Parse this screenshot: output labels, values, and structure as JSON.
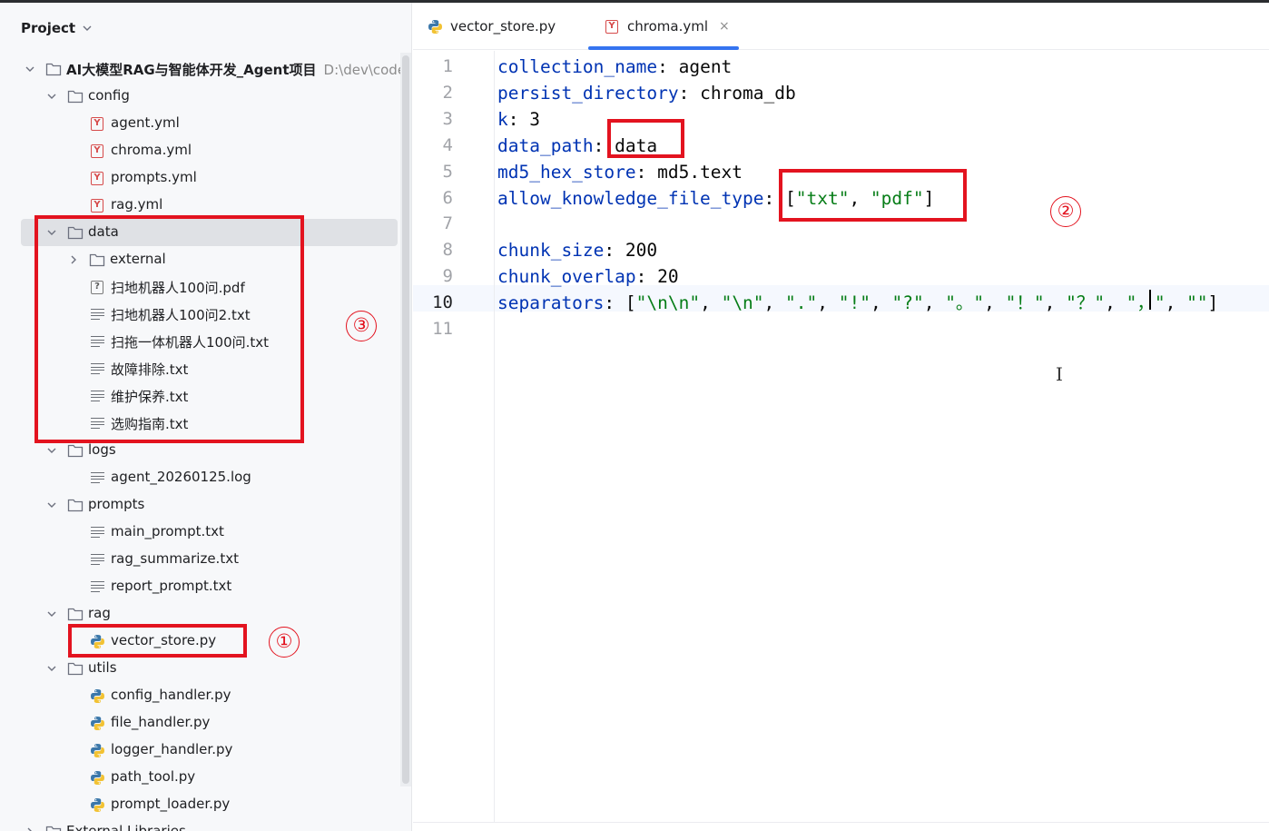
{
  "panel": {
    "title": "Project"
  },
  "tree": [
    {
      "label": "AI大模型RAG与智能体开发_Agent项目",
      "path": "D:\\dev\\code\\p",
      "kind": "folder",
      "expanded": true
    },
    {
      "label": "config",
      "kind": "folder",
      "expanded": true
    },
    {
      "label": "agent.yml",
      "kind": "yml"
    },
    {
      "label": "chroma.yml",
      "kind": "yml"
    },
    {
      "label": "prompts.yml",
      "kind": "yml"
    },
    {
      "label": "rag.yml",
      "kind": "yml"
    },
    {
      "label": "data",
      "kind": "folder",
      "expanded": true,
      "selected": true
    },
    {
      "label": "external",
      "kind": "folder",
      "expanded": false
    },
    {
      "label": "扫地机器人100问.pdf",
      "kind": "pdf"
    },
    {
      "label": "扫地机器人100问2.txt",
      "kind": "txt"
    },
    {
      "label": "扫拖一体机器人100问.txt",
      "kind": "txt"
    },
    {
      "label": "故障排除.txt",
      "kind": "txt"
    },
    {
      "label": "维护保养.txt",
      "kind": "txt"
    },
    {
      "label": "选购指南.txt",
      "kind": "txt"
    },
    {
      "label": "logs",
      "kind": "folder",
      "expanded": true
    },
    {
      "label": "agent_20260125.log",
      "kind": "txt"
    },
    {
      "label": "prompts",
      "kind": "folder",
      "expanded": true
    },
    {
      "label": "main_prompt.txt",
      "kind": "txt"
    },
    {
      "label": "rag_summarize.txt",
      "kind": "txt"
    },
    {
      "label": "report_prompt.txt",
      "kind": "txt"
    },
    {
      "label": "rag",
      "kind": "folder",
      "expanded": true
    },
    {
      "label": "vector_store.py",
      "kind": "py"
    },
    {
      "label": "utils",
      "kind": "folder",
      "expanded": true
    },
    {
      "label": "config_handler.py",
      "kind": "py"
    },
    {
      "label": "file_handler.py",
      "kind": "py"
    },
    {
      "label": "logger_handler.py",
      "kind": "py"
    },
    {
      "label": "path_tool.py",
      "kind": "py"
    },
    {
      "label": "prompt_loader.py",
      "kind": "py"
    },
    {
      "label": "External Libraries",
      "kind": "folder",
      "expanded": false
    }
  ],
  "tabs": [
    {
      "label": "vector_store.py",
      "kind": "py",
      "active": false,
      "closable": false
    },
    {
      "label": "chroma.yml",
      "kind": "yml",
      "active": true,
      "closable": true,
      "close_glyph": "×"
    }
  ],
  "editor": {
    "current_line": 10,
    "lines": [
      {
        "n": "1",
        "key": "collection_name",
        "value": [
          {
            "t": "p",
            "v": "agent"
          }
        ]
      },
      {
        "n": "2",
        "key": "persist_directory",
        "value": [
          {
            "t": "p",
            "v": "chroma_db"
          }
        ]
      },
      {
        "n": "3",
        "key": "k",
        "value": [
          {
            "t": "p",
            "v": "3"
          }
        ]
      },
      {
        "n": "4",
        "key": "data_path",
        "value": [
          {
            "t": "p",
            "v": "data"
          }
        ]
      },
      {
        "n": "5",
        "key": "md5_hex_store",
        "value": [
          {
            "t": "p",
            "v": "md5.text"
          }
        ]
      },
      {
        "n": "6",
        "key": "allow_knowledge_file_type",
        "value": [
          {
            "t": "p",
            "v": "["
          },
          {
            "t": "s",
            "v": "\"txt\""
          },
          {
            "t": "p",
            "v": ", "
          },
          {
            "t": "s",
            "v": "\"pdf\""
          },
          {
            "t": "p",
            "v": "]"
          }
        ]
      },
      {
        "n": "7",
        "key": "",
        "value": []
      },
      {
        "n": "8",
        "key": "chunk_size",
        "value": [
          {
            "t": "p",
            "v": "200"
          }
        ]
      },
      {
        "n": "9",
        "key": "chunk_overlap",
        "value": [
          {
            "t": "p",
            "v": "20"
          }
        ]
      },
      {
        "n": "10",
        "key": "separators",
        "value": [
          {
            "t": "p",
            "v": "["
          },
          {
            "t": "s",
            "v": "\"\\n\\n\""
          },
          {
            "t": "p",
            "v": ", "
          },
          {
            "t": "s",
            "v": "\"\\n\""
          },
          {
            "t": "p",
            "v": ", "
          },
          {
            "t": "s",
            "v": "\".\""
          },
          {
            "t": "p",
            "v": ", "
          },
          {
            "t": "s",
            "v": "\"!\""
          },
          {
            "t": "p",
            "v": ", "
          },
          {
            "t": "s",
            "v": "\"?\""
          },
          {
            "t": "p",
            "v": ", "
          },
          {
            "t": "s",
            "v": "\"。\""
          },
          {
            "t": "p",
            "v": ", "
          },
          {
            "t": "s",
            "v": "\"！\""
          },
          {
            "t": "p",
            "v": ", "
          },
          {
            "t": "s",
            "v": "\"？\""
          },
          {
            "t": "p",
            "v": ", "
          },
          {
            "t": "s",
            "v": "\"，\""
          },
          {
            "t": "p",
            "v": ", "
          },
          {
            "t": "s",
            "v": "\"\""
          },
          {
            "t": "p",
            "v": "]"
          }
        ]
      },
      {
        "n": "11",
        "key": "",
        "value": []
      }
    ]
  },
  "annotations": [
    {
      "id": "1",
      "label": "①",
      "target": "vector_store.py"
    },
    {
      "id": "2",
      "label": "②",
      "target": "allow_knowledge_file_type value"
    },
    {
      "id": "3",
      "label": "③",
      "target": "data folder"
    }
  ],
  "colors": {
    "annotation": "#e3131f",
    "keyword": "#0033b3",
    "string": "#067d17",
    "selection": "#dfe1e5",
    "tab_underline": "#3574f0"
  }
}
